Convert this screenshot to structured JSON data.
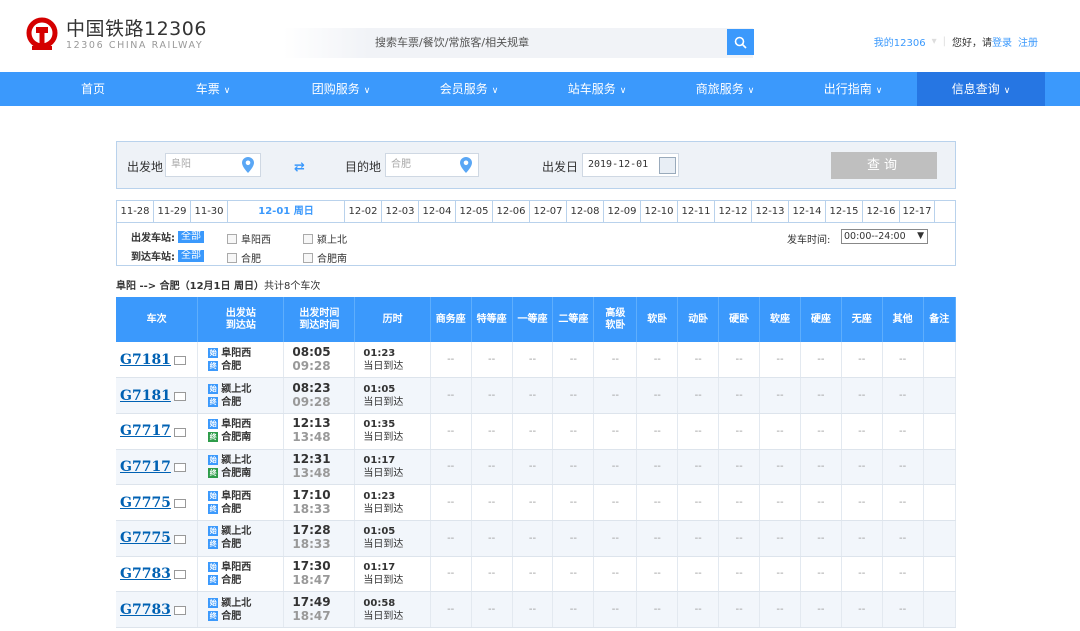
{
  "brand": {
    "name_cn": "中国铁路12306",
    "name_en": "12306 CHINA RAILWAY",
    "logo_color": "#d40000"
  },
  "search": {
    "placeholder": "搜索车票/餐饮/常旅客/相关规章"
  },
  "user": {
    "my": "我的12306",
    "greeting": "您好，请",
    "login": "登录",
    "register": "注册"
  },
  "nav": [
    {
      "label": "首页"
    },
    {
      "label": "车票"
    },
    {
      "label": "团购服务"
    },
    {
      "label": "会员服务"
    },
    {
      "label": "站车服务"
    },
    {
      "label": "商旅服务"
    },
    {
      "label": "出行指南"
    },
    {
      "label": "信息查询"
    }
  ],
  "query": {
    "from_label": "出发地",
    "from_value": "阜阳",
    "to_label": "目的地",
    "to_value": "合肥",
    "date_label": "出发日",
    "date_value": "2019-12-01",
    "button": "查询"
  },
  "dates": [
    "11-28",
    "11-29",
    "11-30",
    "12-01 周日",
    "12-02",
    "12-03",
    "12-04",
    "12-05",
    "12-06",
    "12-07",
    "12-08",
    "12-09",
    "12-10",
    "12-11",
    "12-12",
    "12-13",
    "12-14",
    "12-15",
    "12-16",
    "12-17"
  ],
  "filters": {
    "from_label": "出发车站:",
    "to_label": "到达车站:",
    "all": "全部",
    "from_opts": [
      "阜阳西",
      "颍上北"
    ],
    "to_opts": [
      "合肥",
      "合肥南"
    ],
    "time_label": "发车时间:",
    "time_value": "00:00--24:00"
  },
  "summary": {
    "route": "阜阳 --> 合肥（12月1日 周日）",
    "count_text": "共计8个车次"
  },
  "columns": [
    "车次",
    "出发站\n到达站",
    "出发时间\n到达时间",
    "历时",
    "商务座",
    "特等座",
    "一等座",
    "二等座",
    "高级\n软卧",
    "软卧",
    "动卧",
    "硬卧",
    "软座",
    "硬座",
    "无座",
    "其他",
    "备注"
  ],
  "trains": [
    {
      "no": "G7181",
      "from": "阜阳西",
      "to": "合肥",
      "dep": "08:05",
      "arr": "09:28",
      "dur": "01:23",
      "day": "当日到达",
      "to_icon": "b"
    },
    {
      "no": "G7181",
      "from": "颍上北",
      "to": "合肥",
      "dep": "08:23",
      "arr": "09:28",
      "dur": "01:05",
      "day": "当日到达",
      "to_icon": "b"
    },
    {
      "no": "G7717",
      "from": "阜阳西",
      "to": "合肥南",
      "dep": "12:13",
      "arr": "13:48",
      "dur": "01:35",
      "day": "当日到达",
      "to_icon": "g"
    },
    {
      "no": "G7717",
      "from": "颍上北",
      "to": "合肥南",
      "dep": "12:31",
      "arr": "13:48",
      "dur": "01:17",
      "day": "当日到达",
      "to_icon": "g"
    },
    {
      "no": "G7775",
      "from": "阜阳西",
      "to": "合肥",
      "dep": "17:10",
      "arr": "18:33",
      "dur": "01:23",
      "day": "当日到达",
      "to_icon": "b"
    },
    {
      "no": "G7775",
      "from": "颍上北",
      "to": "合肥",
      "dep": "17:28",
      "arr": "18:33",
      "dur": "01:05",
      "day": "当日到达",
      "to_icon": "b"
    },
    {
      "no": "G7783",
      "from": "阜阳西",
      "to": "合肥",
      "dep": "17:30",
      "arr": "18:47",
      "dur": "01:17",
      "day": "当日到达",
      "to_icon": "b"
    },
    {
      "no": "G7783",
      "from": "颍上北",
      "to": "合肥",
      "dep": "17:49",
      "arr": "18:47",
      "dur": "00:58",
      "day": "当日到达",
      "to_icon": "b"
    }
  ],
  "seat_empty": "--",
  "colors": {
    "primary": "#3b99fc",
    "nav_active": "#2676e3",
    "train_link": "#0061b3"
  }
}
